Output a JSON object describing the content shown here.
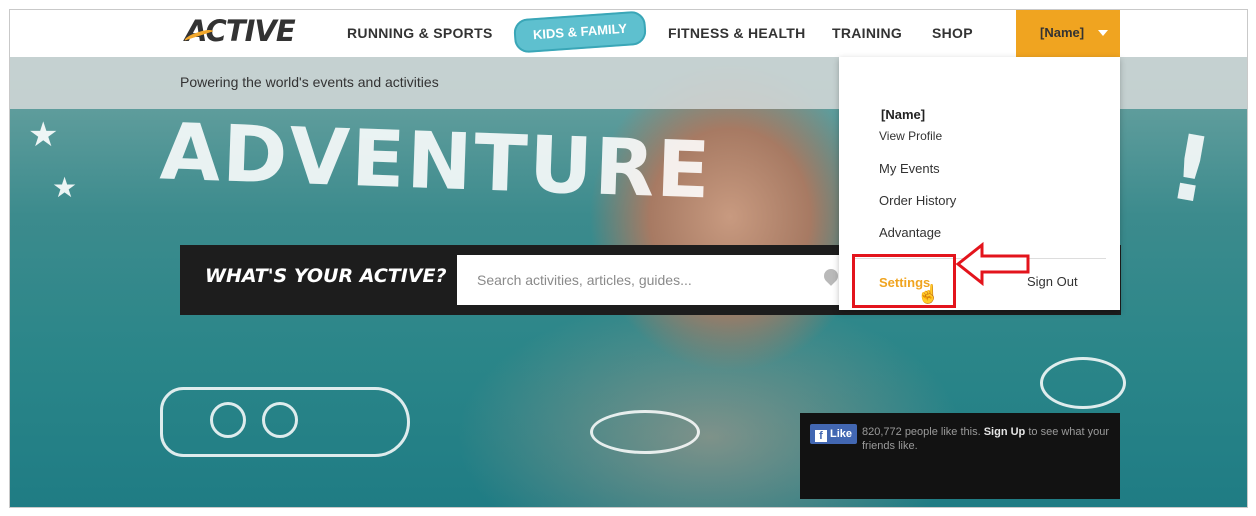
{
  "header": {
    "logo": "ACTIVE",
    "nav": [
      {
        "label": "RUNNING & SPORTS"
      },
      {
        "label": "KIDS & FAMILY"
      },
      {
        "label": "FITNESS & HEALTH"
      },
      {
        "label": "TRAINING"
      },
      {
        "label": "SHOP"
      }
    ],
    "user_button": "[Name]"
  },
  "tagline": "Powering the world's events and activities",
  "hero": {
    "headline": "ADVENTURE",
    "search_label": "WHAT'S YOUR ACTIVE?",
    "search_placeholder": "Search activities, articles, guides..."
  },
  "user_menu": {
    "name": "[Name]",
    "links": [
      "View Profile",
      "My Events",
      "Order History",
      "Advantage"
    ],
    "settings": "Settings",
    "sign_out": "Sign Out"
  },
  "facebook": {
    "like_label": "Like",
    "count_text": "820,772 people like this.",
    "signup_label": "Sign Up",
    "suffix": "to see what your friends like."
  },
  "colors": {
    "accent": "#f0a420",
    "annotation": "#e3141c",
    "kids_ribbon": "#5ec0cf",
    "fb_blue": "#4267b2"
  }
}
